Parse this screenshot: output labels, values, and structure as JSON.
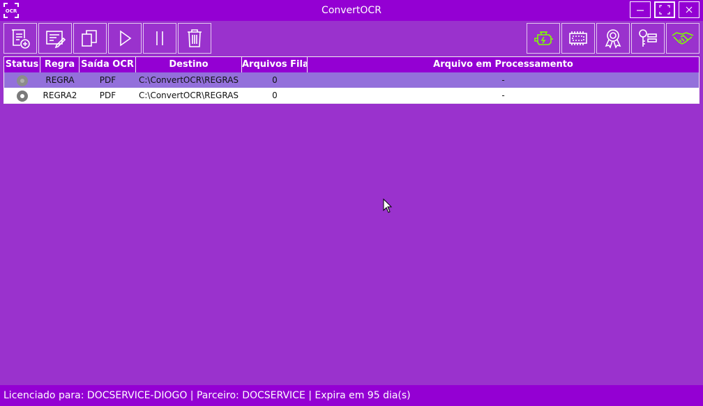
{
  "window": {
    "title": "ConvertOCR",
    "logo_text": "OCR"
  },
  "colors": {
    "titlebar": "#9400d3",
    "background": "#9a32cd",
    "selected_row": "#9370db",
    "engine_icon": "#7fff00",
    "handshake_icon": "#7fff00"
  },
  "toolbar": {
    "left": [
      {
        "name": "add-rule",
        "icon": "document-plus-icon"
      },
      {
        "name": "edit-rule",
        "icon": "document-edit-icon"
      },
      {
        "name": "copy-rule",
        "icon": "copy-icon"
      },
      {
        "name": "start",
        "icon": "play-icon"
      },
      {
        "name": "pause",
        "icon": "pause-icon"
      },
      {
        "name": "delete-rule",
        "icon": "trash-icon"
      }
    ],
    "right": [
      {
        "name": "engine",
        "icon": "engine-icon"
      },
      {
        "name": "memory",
        "icon": "chip-icon"
      },
      {
        "name": "certificate",
        "icon": "award-icon"
      },
      {
        "name": "license-key",
        "icon": "key-icon"
      },
      {
        "name": "partner",
        "icon": "handshake-icon"
      }
    ]
  },
  "grid": {
    "columns": [
      "Status",
      "Regra",
      "Saída OCR",
      "Destino",
      "Arquivos Fila",
      "Arquivo em Processamento"
    ],
    "rows": [
      {
        "regra": "REGRA",
        "saida": "PDF",
        "destino": "C:\\ConvertOCR\\REGRAS",
        "fila": "0",
        "processando": "-"
      },
      {
        "regra": "REGRA2",
        "saida": "PDF",
        "destino": "C:\\ConvertOCR\\REGRAS",
        "fila": "0",
        "processando": "-"
      }
    ]
  },
  "statusbar": {
    "text": "Licenciado para: DOCSERVICE-DIOGO | Parceiro: DOCSERVICE | Expira em 95 dia(s)"
  }
}
